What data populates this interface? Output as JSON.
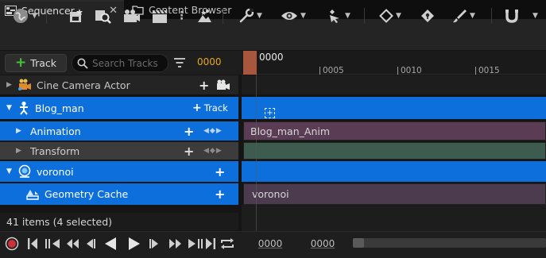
{
  "tabs": [
    {
      "label": "Sequencer",
      "icon": "sequencer-icon",
      "active": true
    },
    {
      "label": "Content Browser",
      "icon": "content-browser-icon",
      "active": false
    }
  ],
  "toolbar": {
    "icons": [
      "world-icon",
      "save-icon",
      "find-asset-icon",
      "render-movie-icon",
      "clapper-icon",
      "more-icon",
      "actor-icon",
      "wrench-icon",
      "eye-icon",
      "auto-key-icon",
      "diamond-key-icon",
      "lock-key-icon",
      "brush-icon",
      "magnet-icon"
    ]
  },
  "outliner": {
    "add_track_label": "Track",
    "search_placeholder": "Search Tracks",
    "current_frame": "0000"
  },
  "ruler": {
    "playhead_label": "0000",
    "tick_labels": [
      "0005",
      "0010",
      "0015"
    ]
  },
  "tracks": [
    {
      "label": "Cine Camera Actor",
      "icon": "camera-actor-icon",
      "selected": false
    },
    {
      "label": "Blog_man",
      "icon": "skeletal-mesh-icon",
      "selected": true,
      "add_label": "Track"
    },
    {
      "label": "Animation",
      "selected": true
    },
    {
      "label": "Transform",
      "selected": false
    },
    {
      "label": "voronoi",
      "icon": "geometry-actor-icon",
      "selected": true
    },
    {
      "label": "Geometry Cache",
      "icon": "geometry-cache-icon",
      "selected": true
    }
  ],
  "sections": {
    "animation": "Blog_man_Anim",
    "geometry_cache": "voronoi"
  },
  "status": "41 items (4 selected)",
  "transport": {
    "start_frame": "0000",
    "end_frame": "0000"
  },
  "colors": {
    "selection_blue": "#0d6fdb",
    "playhead": "#a8563c",
    "frame_orange": "#e8a62a",
    "anim_section": "#5a3d55",
    "transform_section": "#3d5c4f",
    "record_red": "#d0303a",
    "add_green": "#46c33a"
  }
}
